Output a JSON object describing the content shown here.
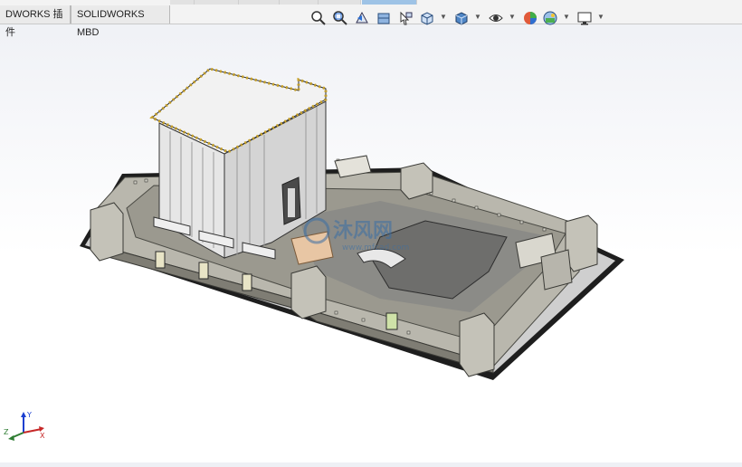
{
  "tabs": [
    {
      "label": "DWORKS 插件"
    },
    {
      "label": "SOLIDWORKS MBD"
    }
  ],
  "heads_up_toolbar": [
    {
      "icon": "zoom-to-fit-icon"
    },
    {
      "icon": "zoom-to-area-icon"
    },
    {
      "icon": "previous-view-icon"
    },
    {
      "icon": "section-view-icon"
    },
    {
      "icon": "dynamic-annotation-icon"
    },
    {
      "icon": "view-orientation-icon"
    },
    {
      "icon": "display-style-icon"
    },
    {
      "icon": "hide-show-items-icon"
    },
    {
      "icon": "edit-appearance-icon"
    },
    {
      "icon": "apply-scene-icon"
    },
    {
      "icon": "view-settings-icon"
    }
  ],
  "model": {
    "watermark": "沐风网",
    "watermark_url": "www.mfcad.com"
  },
  "triad": {
    "x_label": "X",
    "y_label": "Y",
    "z_label": "Z"
  },
  "colors": {
    "wall": "#b9b7ad",
    "wall_dark": "#8d8b82",
    "roof": "#f2f2f2",
    "gold": "#c9a227",
    "base": "#1e1e1e",
    "accent_blue": "#3a6ea5"
  }
}
